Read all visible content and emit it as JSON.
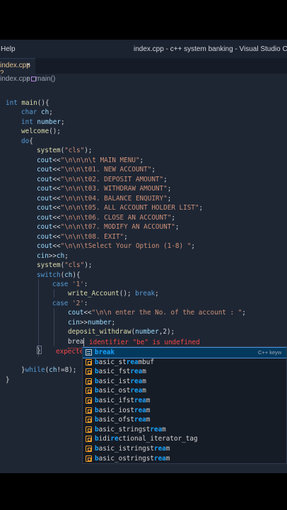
{
  "window": {
    "menu_help": "Help",
    "title": "index.cpp - c++ system banking - Visual Studio Code"
  },
  "tab": {
    "name": "index.cpp 2",
    "close_glyph": "×"
  },
  "breadcrumb": {
    "file": "index.cpp",
    "separator": "›",
    "function": "main()"
  },
  "code_lines": [
    [
      [
        "kw",
        "int "
      ],
      [
        "fn",
        "main"
      ],
      [
        "op",
        "(){"
      ]
    ],
    [
      [
        "kw",
        "char "
      ],
      [
        "var",
        "ch"
      ],
      [
        "op",
        ";"
      ]
    ],
    [
      [
        "kw",
        "int "
      ],
      [
        "var",
        "number"
      ],
      [
        "op",
        ";"
      ]
    ],
    [
      [
        "fn",
        "welcome"
      ],
      [
        "op",
        "();"
      ]
    ],
    [
      [
        "kw",
        "do"
      ],
      [
        "op",
        "{"
      ]
    ],
    [
      [
        "fn",
        "system"
      ],
      [
        "op",
        "("
      ],
      [
        "str",
        "\"cls\""
      ],
      [
        "op",
        ");"
      ]
    ],
    [
      [
        "var",
        "cout"
      ],
      [
        "op",
        "<<"
      ],
      [
        "str",
        "\"\\n\\n\\n\\t MAIN MENU\""
      ],
      [
        "op",
        ";"
      ]
    ],
    [
      [
        "var",
        "cout"
      ],
      [
        "op",
        "<<"
      ],
      [
        "str",
        "\"\\n\\n\\t01. NEW ACCOUNT\""
      ],
      [
        "op",
        ";"
      ]
    ],
    [
      [
        "var",
        "cout"
      ],
      [
        "op",
        "<<"
      ],
      [
        "str",
        "\"\\n\\n\\t02. DEPOSIT AMOUNT\""
      ],
      [
        "op",
        ";"
      ]
    ],
    [
      [
        "var",
        "cout"
      ],
      [
        "op",
        "<<"
      ],
      [
        "str",
        "\"\\n\\n\\t03. WITHDRAW AMOUNT\""
      ],
      [
        "op",
        ";"
      ]
    ],
    [
      [
        "var",
        "cout"
      ],
      [
        "op",
        "<<"
      ],
      [
        "str",
        "\"\\n\\n\\t04. BALANCE ENQUIRY\""
      ],
      [
        "op",
        ";"
      ]
    ],
    [
      [
        "var",
        "cout"
      ],
      [
        "op",
        "<<"
      ],
      [
        "str",
        "\"\\n\\n\\t05. ALL ACCOUNT HOLDER LIST\""
      ],
      [
        "op",
        ";"
      ]
    ],
    [
      [
        "var",
        "cout"
      ],
      [
        "op",
        "<<"
      ],
      [
        "str",
        "\"\\n\\n\\t06. CLOSE AN ACCOUNT\""
      ],
      [
        "op",
        ";"
      ]
    ],
    [
      [
        "var",
        "cout"
      ],
      [
        "op",
        "<<"
      ],
      [
        "str",
        "\"\\n\\n\\t07. MODIFY AN ACCOUNT\""
      ],
      [
        "op",
        ";"
      ]
    ],
    [
      [
        "var",
        "cout"
      ],
      [
        "op",
        "<<"
      ],
      [
        "str",
        "\"\\n\\n\\t08. EXIT\""
      ],
      [
        "op",
        ";"
      ]
    ],
    [
      [
        "var",
        "cout"
      ],
      [
        "op",
        "<<"
      ],
      [
        "str",
        "\"\\n\\n\\tSelect Your Option (1-8) \""
      ],
      [
        "op",
        ";"
      ]
    ],
    [
      [
        "var",
        "cin"
      ],
      [
        "op",
        ">>"
      ],
      [
        "var",
        "ch"
      ],
      [
        "op",
        ";"
      ]
    ],
    [
      [
        "fn",
        "system"
      ],
      [
        "op",
        "("
      ],
      [
        "str",
        "\"cls\""
      ],
      [
        "op",
        ");"
      ]
    ],
    [
      [
        "kw",
        "switch"
      ],
      [
        "op",
        "("
      ],
      [
        "var",
        "ch"
      ],
      [
        "op",
        "){"
      ]
    ],
    [
      [
        "kw",
        "case "
      ],
      [
        "str",
        "'1'"
      ],
      [
        "op",
        ":"
      ]
    ],
    [
      [
        "fn",
        "write_Account"
      ],
      [
        "op",
        "(); "
      ],
      [
        "kw",
        "break"
      ],
      [
        "op",
        ";"
      ]
    ],
    [
      [
        "kw",
        "case "
      ],
      [
        "str",
        "'2'"
      ],
      [
        "op",
        ":"
      ]
    ],
    [
      [
        "var",
        "cout"
      ],
      [
        "op",
        "<<"
      ],
      [
        "str",
        "\"\\n\\n enter the No. of the account : \""
      ],
      [
        "op",
        ";"
      ]
    ],
    [
      [
        "var",
        "cin"
      ],
      [
        "op",
        ">>"
      ],
      [
        "var",
        "number"
      ],
      [
        "op",
        ";"
      ]
    ],
    [
      [
        "fn",
        "deposit_withdraw"
      ],
      [
        "op",
        "("
      ],
      [
        "var",
        "number"
      ],
      [
        "op",
        ",2);"
      ]
    ],
    [
      [
        "op",
        "brea"
      ]
    ],
    [
      [
        "op",
        "}"
      ]
    ],
    [
      [
        "op",
        ""
      ]
    ],
    [
      [
        "op",
        "}"
      ],
      [
        "kw",
        "while"
      ],
      [
        "op",
        "("
      ],
      [
        "var",
        "ch"
      ],
      [
        "op",
        "!=8);"
      ]
    ],
    [
      [
        "op",
        ""
      ]
    ],
    [
      [
        "op",
        "}"
      ]
    ]
  ],
  "diagnostics": {
    "identifier_error": "identifier \"be\" is undefined",
    "expected_text": "expecte"
  },
  "suggestions": {
    "typed": "brea",
    "detail": "C++ keyw",
    "items": [
      {
        "match": "break",
        "rest": "",
        "kind": "keyword"
      },
      {
        "match": "b",
        "mid1": "asic_st",
        "match2": "rea",
        "rest": "mbuf",
        "kind": "class"
      },
      {
        "match": "b",
        "mid1": "asic_fst",
        "match2": "rea",
        "rest": "m",
        "kind": "class"
      },
      {
        "match": "b",
        "mid1": "asic_ist",
        "match2": "rea",
        "rest": "m",
        "kind": "class"
      },
      {
        "match": "b",
        "mid1": "asic_ost",
        "match2": "rea",
        "rest": "m",
        "kind": "class"
      },
      {
        "match": "b",
        "mid1": "asic_ifst",
        "match2": "rea",
        "rest": "m",
        "kind": "class"
      },
      {
        "match": "b",
        "mid1": "asic_iost",
        "match2": "rea",
        "rest": "m",
        "kind": "class"
      },
      {
        "match": "b",
        "mid1": "asic_ofst",
        "match2": "rea",
        "rest": "m",
        "kind": "class"
      },
      {
        "match": "b",
        "mid1": "asic_stringst",
        "match2": "rea",
        "rest": "m",
        "kind": "class"
      },
      {
        "match": "b",
        "mid1": "idi",
        "match2": "re",
        "rest": "ctional_iterator_tag",
        "kind": "class"
      },
      {
        "match": "b",
        "mid1": "asic_istringst",
        "match2": "rea",
        "rest": "m",
        "kind": "class"
      },
      {
        "match": "b",
        "mid1": "asic_ostringst",
        "match2": "rea",
        "rest": "m",
        "kind": "class"
      }
    ]
  },
  "colors": {
    "editor_bg": "#1e2634",
    "keyword": "#569cd6",
    "string": "#ce9178",
    "function": "#dcdcaa",
    "variable": "#9cdcfe",
    "error": "#f44747",
    "match_highlight": "#18a3ff"
  }
}
